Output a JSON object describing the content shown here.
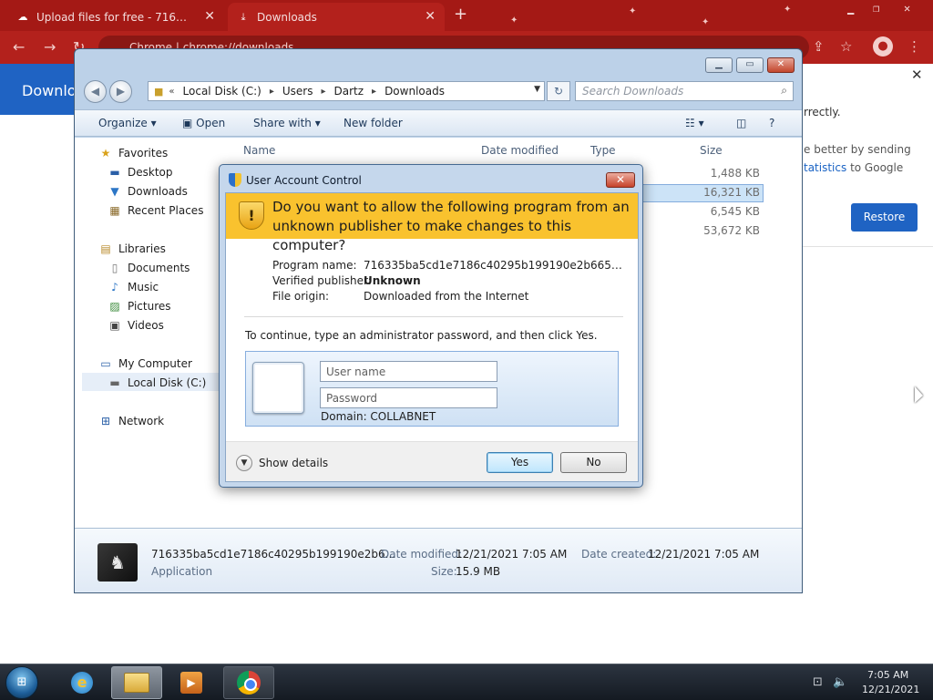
{
  "chrome": {
    "tabs": [
      {
        "title": "Upload files for free - 716335ba",
        "icon": "cloud-upload-icon"
      },
      {
        "title": "Downloads",
        "icon": "download-icon"
      }
    ],
    "url_text": "Chrome  |  chrome://downloads",
    "page_title": "Downloads",
    "notice": {
      "line1": "rrectly.",
      "line2": "e better by sending",
      "line3_link": "tatistics",
      "line3_rest": " to Google",
      "restore_label": "Restore"
    },
    "colors": {
      "frame": "#a41915",
      "toolbar": "#b3211c",
      "accent": "#1f63c3"
    }
  },
  "explorer": {
    "breadcrumb": [
      "Local Disk (C:)",
      "Users",
      "Dartz",
      "Downloads"
    ],
    "search_placeholder": "Search Downloads",
    "commands": {
      "organize": "Organize",
      "open": "Open",
      "share_with": "Share with",
      "new_folder": "New folder"
    },
    "nav": {
      "favorites": "Favorites",
      "desktop": "Desktop",
      "downloads": "Downloads",
      "recent_places": "Recent Places",
      "libraries": "Libraries",
      "documents": "Documents",
      "music": "Music",
      "pictures": "Pictures",
      "videos": "Videos",
      "my_computer": "My Computer",
      "local_disk": "Local Disk (C:)",
      "network": "Network"
    },
    "columns": {
      "name": "Name",
      "date_modified": "Date modified",
      "type": "Type",
      "size": "Size"
    },
    "file_sizes": [
      "1,488 KB",
      "16,321 KB",
      "6,545 KB",
      "53,672 KB"
    ],
    "details": {
      "filename": "716335ba5cd1e7186c40295b199190e2b6...",
      "file_type": "Application",
      "date_modified_label": "Date modified:",
      "date_modified_value": "12/21/2021 7:05 AM",
      "size_label": "Size:",
      "size_value": "15.9 MB",
      "date_created_label": "Date created:",
      "date_created_value": "12/21/2021 7:05 AM"
    }
  },
  "uac": {
    "title": "User Account Control",
    "question": "Do you want to allow the following program from an unknown publisher to make changes to this computer?",
    "program_name_label": "Program name:",
    "program_name_value": "716335ba5cd1e7186c40295b199190e2b6655e48f1c1c...",
    "publisher_label": "Verified publisher:",
    "publisher_value": "Unknown",
    "origin_label": "File origin:",
    "origin_value": "Downloaded from the Internet",
    "instruction": "To continue, type an administrator password, and then click Yes.",
    "username_placeholder": "User name",
    "password_placeholder": "Password",
    "domain": "Domain: COLLABNET",
    "show_details": "Show details",
    "yes_label": "Yes",
    "no_label": "No",
    "colors": {
      "banner": "#f9c22e",
      "frame": "#c5d7ec"
    }
  },
  "taskbar": {
    "clock_time": "7:05 AM",
    "clock_date": "12/21/2021",
    "pinned": [
      "internet-explorer-icon",
      "windows-explorer-icon",
      "media-player-icon",
      "chrome-icon"
    ]
  }
}
